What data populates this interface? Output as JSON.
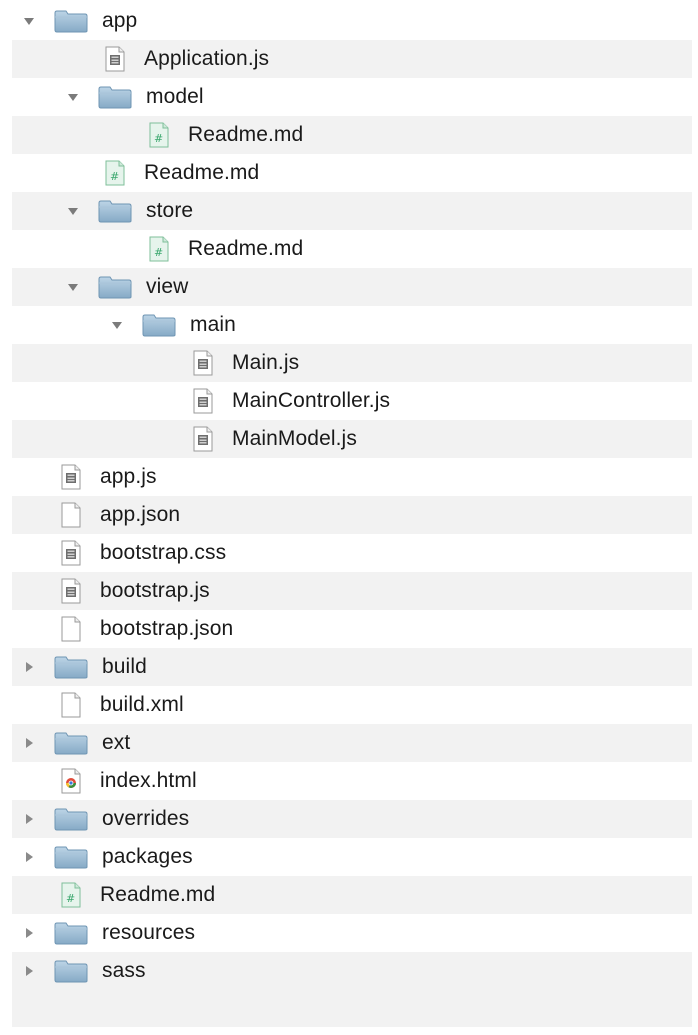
{
  "tree": {
    "items": [
      {
        "label": "app",
        "kind": "folder",
        "expanded": true,
        "depth": 0,
        "icon": "folder-icon"
      },
      {
        "label": "Application.js",
        "kind": "file-js",
        "depth": 1,
        "icon": "js-file-icon"
      },
      {
        "label": "model",
        "kind": "folder",
        "expanded": true,
        "depth": 1,
        "icon": "folder-icon"
      },
      {
        "label": "Readme.md",
        "kind": "file-md",
        "depth": 2,
        "icon": "markdown-file-icon"
      },
      {
        "label": "Readme.md",
        "kind": "file-md",
        "depth": 1,
        "icon": "markdown-file-icon"
      },
      {
        "label": "store",
        "kind": "folder",
        "expanded": true,
        "depth": 1,
        "icon": "folder-icon"
      },
      {
        "label": "Readme.md",
        "kind": "file-md",
        "depth": 2,
        "icon": "markdown-file-icon"
      },
      {
        "label": "view",
        "kind": "folder",
        "expanded": true,
        "depth": 1,
        "icon": "folder-icon"
      },
      {
        "label": "main",
        "kind": "folder",
        "expanded": true,
        "depth": 2,
        "icon": "folder-icon"
      },
      {
        "label": "Main.js",
        "kind": "file-js",
        "depth": 3,
        "icon": "js-file-icon"
      },
      {
        "label": "MainController.js",
        "kind": "file-js",
        "depth": 3,
        "icon": "js-file-icon"
      },
      {
        "label": "MainModel.js",
        "kind": "file-js",
        "depth": 3,
        "icon": "js-file-icon"
      },
      {
        "label": "app.js",
        "kind": "file-js",
        "depth": 0,
        "icon": "js-file-icon"
      },
      {
        "label": "app.json",
        "kind": "file-plain",
        "depth": 0,
        "icon": "blank-file-icon"
      },
      {
        "label": "bootstrap.css",
        "kind": "file-js",
        "depth": 0,
        "icon": "css-file-icon"
      },
      {
        "label": "bootstrap.js",
        "kind": "file-js",
        "depth": 0,
        "icon": "js-file-icon"
      },
      {
        "label": "bootstrap.json",
        "kind": "file-plain",
        "depth": 0,
        "icon": "blank-file-icon"
      },
      {
        "label": "build",
        "kind": "folder",
        "expanded": false,
        "depth": 0,
        "icon": "folder-icon"
      },
      {
        "label": "build.xml",
        "kind": "file-plain",
        "depth": 0,
        "icon": "blank-file-icon"
      },
      {
        "label": "ext",
        "kind": "folder",
        "expanded": false,
        "depth": 0,
        "icon": "folder-icon"
      },
      {
        "label": "index.html",
        "kind": "file-html",
        "depth": 0,
        "icon": "html-file-icon"
      },
      {
        "label": "overrides",
        "kind": "folder",
        "expanded": false,
        "depth": 0,
        "icon": "folder-icon"
      },
      {
        "label": "packages",
        "kind": "folder",
        "expanded": false,
        "depth": 0,
        "icon": "folder-icon"
      },
      {
        "label": "Readme.md",
        "kind": "file-md",
        "depth": 0,
        "icon": "markdown-file-icon"
      },
      {
        "label": "resources",
        "kind": "folder",
        "expanded": false,
        "depth": 0,
        "icon": "folder-icon"
      },
      {
        "label": "sass",
        "kind": "folder",
        "expanded": false,
        "depth": 0,
        "icon": "folder-icon"
      }
    ]
  },
  "colors": {
    "row_stripe": "#f2f2f2",
    "folder": "#8fb3cf",
    "md_accent": "#3aa76d"
  }
}
